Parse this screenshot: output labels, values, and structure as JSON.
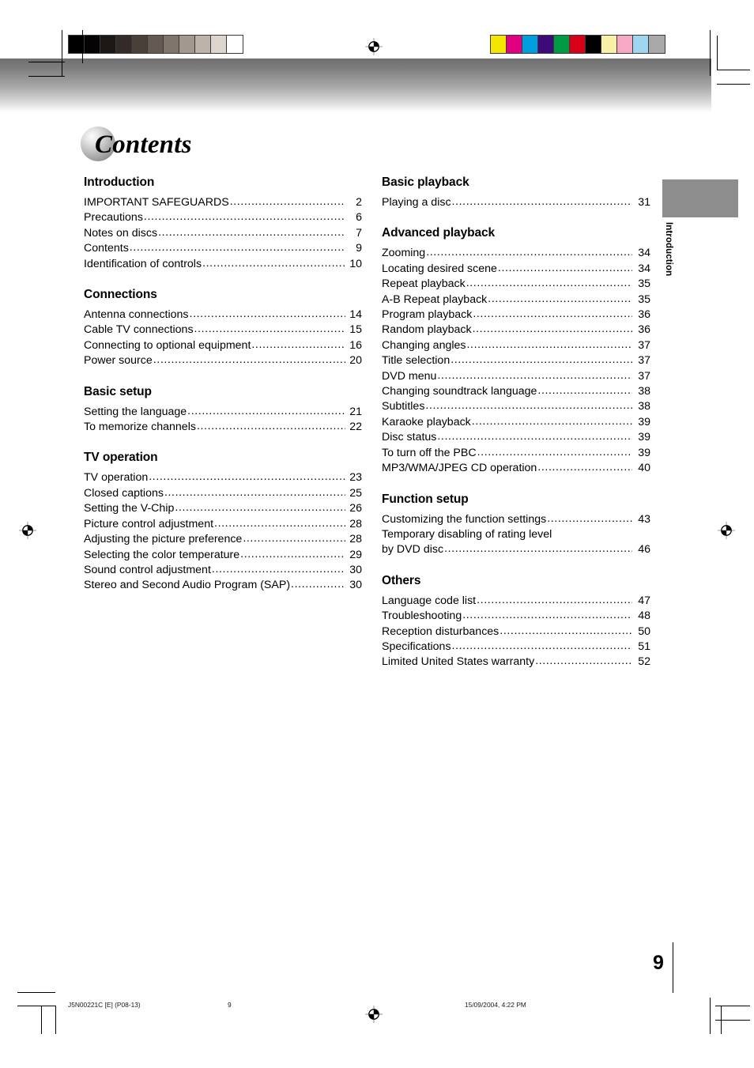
{
  "document": {
    "title": "Contents",
    "page_number": "9",
    "side_tab_label": "Introduction"
  },
  "columns": {
    "left": [
      {
        "heading": "Introduction",
        "entries": [
          {
            "label": "IMPORTANT SAFEGUARDS",
            "page": "2"
          },
          {
            "label": "Precautions",
            "page": "6"
          },
          {
            "label": "Notes on discs",
            "page": "7"
          },
          {
            "label": "Contents",
            "page": "9"
          },
          {
            "label": "Identification of controls",
            "page": "10"
          }
        ]
      },
      {
        "heading": "Connections",
        "entries": [
          {
            "label": "Antenna connections",
            "page": "14"
          },
          {
            "label": "Cable TV connections",
            "page": "15"
          },
          {
            "label": "Connecting to optional equipment",
            "page": "16"
          },
          {
            "label": "Power source",
            "page": "20"
          }
        ]
      },
      {
        "heading": "Basic setup",
        "entries": [
          {
            "label": "Setting the language",
            "page": "21"
          },
          {
            "label": "To memorize channels",
            "page": "22"
          }
        ]
      },
      {
        "heading": "TV operation",
        "entries": [
          {
            "label": "TV operation",
            "page": "23"
          },
          {
            "label": "Closed captions",
            "page": "25"
          },
          {
            "label": "Setting the V-Chip",
            "page": "26"
          },
          {
            "label": "Picture control adjustment",
            "page": "28"
          },
          {
            "label": "Adjusting the picture preference",
            "page": "28"
          },
          {
            "label": "Selecting the color temperature",
            "page": "29"
          },
          {
            "label": "Sound control adjustment",
            "page": "30"
          },
          {
            "label": "Stereo and Second Audio Program (SAP)",
            "page": "30"
          }
        ]
      }
    ],
    "right": [
      {
        "heading": "Basic playback",
        "entries": [
          {
            "label": "Playing a disc",
            "page": "31"
          }
        ]
      },
      {
        "heading": "Advanced playback",
        "entries": [
          {
            "label": "Zooming",
            "page": "34"
          },
          {
            "label": "Locating desired scene",
            "page": "34"
          },
          {
            "label": "Repeat playback",
            "page": "35"
          },
          {
            "label": "A-B Repeat playback",
            "page": "35"
          },
          {
            "label": "Program playback",
            "page": "36"
          },
          {
            "label": "Random playback",
            "page": "36"
          },
          {
            "label": "Changing angles",
            "page": "37"
          },
          {
            "label": "Title selection",
            "page": "37"
          },
          {
            "label": "DVD menu",
            "page": "37"
          },
          {
            "label": "Changing soundtrack language",
            "page": "38"
          },
          {
            "label": "Subtitles",
            "page": "38"
          },
          {
            "label": "Karaoke playback",
            "page": "39"
          },
          {
            "label": "Disc status",
            "page": "39"
          },
          {
            "label": "To turn off the PBC",
            "page": "39"
          },
          {
            "label": "MP3/WMA/JPEG CD operation",
            "page": "40"
          }
        ]
      },
      {
        "heading": "Function setup",
        "entries": [
          {
            "label": "Customizing the function settings",
            "page": "43"
          },
          {
            "label": "Temporary disabling of rating level",
            "page": "",
            "no_leader": true
          },
          {
            "label": "by DVD disc",
            "page": "46"
          }
        ]
      },
      {
        "heading": "Others",
        "entries": [
          {
            "label": "Language code list",
            "page": "47"
          },
          {
            "label": "Troubleshooting",
            "page": "48"
          },
          {
            "label": "Reception disturbances",
            "page": "50"
          },
          {
            "label": "Specifications",
            "page": "51"
          },
          {
            "label": "Limited United States warranty",
            "page": "52"
          }
        ]
      }
    ]
  },
  "footer": {
    "doc_code": "J5N00221C [E] (P08-13)",
    "page_label": "9",
    "timestamp": "15/09/2004, 4:22 PM"
  },
  "calibration": {
    "gray_strip": [
      "#000000",
      "#050303",
      "#1b1715",
      "#332b27",
      "#4a403a",
      "#655a53",
      "#80756d",
      "#a3988f",
      "#bdb3ab",
      "#dcd6cf",
      "#ffffff"
    ],
    "color_strip": [
      "#f5e600",
      "#e00080",
      "#009ee0",
      "#3d0a7a",
      "#009944",
      "#d80019",
      "#000000",
      "#f9f0a8",
      "#f6a8c4",
      "#9fd6f2",
      "#a8a8a8"
    ],
    "tab_gray": "#8d8d8d"
  }
}
